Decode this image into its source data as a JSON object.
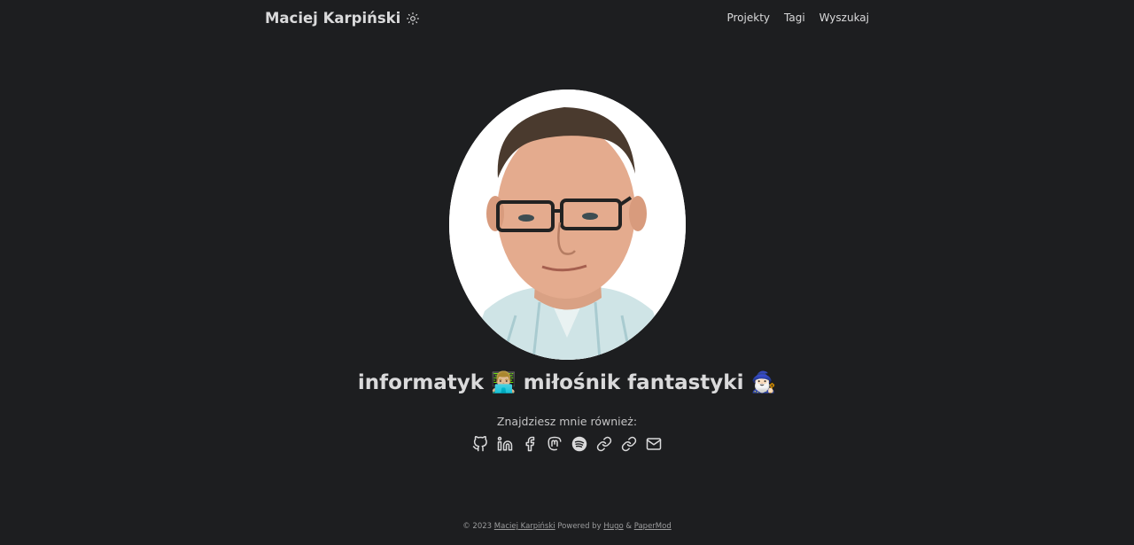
{
  "header": {
    "site_title": "Maciej Karpiński",
    "theme_icon": "sun-icon",
    "menu": [
      {
        "label": "Projekty"
      },
      {
        "label": "Tagi"
      },
      {
        "label": "Wyszukaj"
      }
    ]
  },
  "profile": {
    "avatar_alt": "portrait-photo",
    "headline": "informatyk 👨🏼‍💻 miłośnik fantastyki 🧙🏻‍♂️",
    "subtitle": "Znajdziesz mnie również:",
    "social_icons": [
      "github-icon",
      "linkedin-icon",
      "facebook-icon",
      "mastodon-icon",
      "spotify-icon",
      "link-icon",
      "link-icon",
      "mail-icon"
    ]
  },
  "footer": {
    "copyright": "© 2023",
    "author": "Maciej Karpiński",
    "powered_by": "Powered by",
    "hugo": "Hugo",
    "amp": "&",
    "theme": "PaperMod"
  },
  "colors": {
    "background": "#1d1e20",
    "text": "#dadadb",
    "secondary": "#9b9c9d"
  }
}
